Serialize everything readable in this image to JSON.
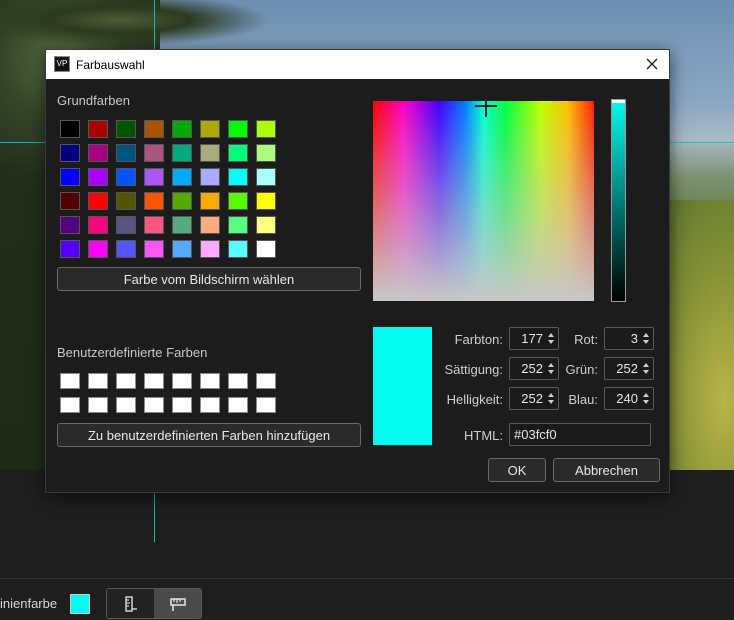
{
  "dialog": {
    "title": "Farbauswahl",
    "app_icon_text": "VP",
    "basic_colors_label": "Grundfarben",
    "basic_colors": [
      "#000000",
      "#aa0000",
      "#005500",
      "#aa5500",
      "#00aa00",
      "#aaaa00",
      "#00ff00",
      "#aaff00",
      "#00007f",
      "#aa007f",
      "#00557f",
      "#aa557f",
      "#00aa7f",
      "#aaaa7f",
      "#00ff7f",
      "#aaff7f",
      "#0000ff",
      "#aa00ff",
      "#0055ff",
      "#aa55ff",
      "#00aaff",
      "#aaaaff",
      "#00ffff",
      "#aaffff",
      "#550000",
      "#ff0000",
      "#555500",
      "#ff5500",
      "#55aa00",
      "#ffaa00",
      "#55ff00",
      "#ffff00",
      "#55007f",
      "#ff007f",
      "#55557f",
      "#ff557f",
      "#55aa7f",
      "#ffaa7f",
      "#55ff7f",
      "#ffff7f",
      "#5500ff",
      "#ff00ff",
      "#5555ff",
      "#ff55ff",
      "#55aaff",
      "#ffaaff",
      "#55ffff",
      "#ffffff"
    ],
    "pick_screen_button": "Farbe vom Bildschirm wählen",
    "custom_colors_label": "Benutzerdefinierte Farben",
    "custom_colors": [
      "#ffffff",
      "#ffffff",
      "#ffffff",
      "#ffffff",
      "#ffffff",
      "#ffffff",
      "#ffffff",
      "#ffffff",
      "#ffffff",
      "#ffffff",
      "#ffffff",
      "#ffffff",
      "#ffffff",
      "#ffffff",
      "#ffffff",
      "#ffffff"
    ],
    "add_custom_button": "Zu benutzerdefinierten Farben hinzufügen",
    "current_color": "#03fcf0",
    "fields": {
      "hue_label": "Farbton:",
      "hue_value": "177",
      "sat_label": "Sättigung:",
      "sat_value": "252",
      "val_label": "Helligkeit:",
      "val_value": "252",
      "red_label": "Rot:",
      "red_value": "3",
      "green_label": "Grün:",
      "green_value": "252",
      "blue_label": "Blau:",
      "blue_value": "240",
      "html_label": "HTML:",
      "html_value": "#03fcf0"
    },
    "ok_button": "OK",
    "cancel_button": "Abbrechen"
  },
  "toolbar": {
    "line_color_label": "inienfarbe",
    "line_color_value": "#03fcf0",
    "ruler_icon_1": "ruler-icon",
    "ruler_icon_2": "ruler-icon"
  }
}
